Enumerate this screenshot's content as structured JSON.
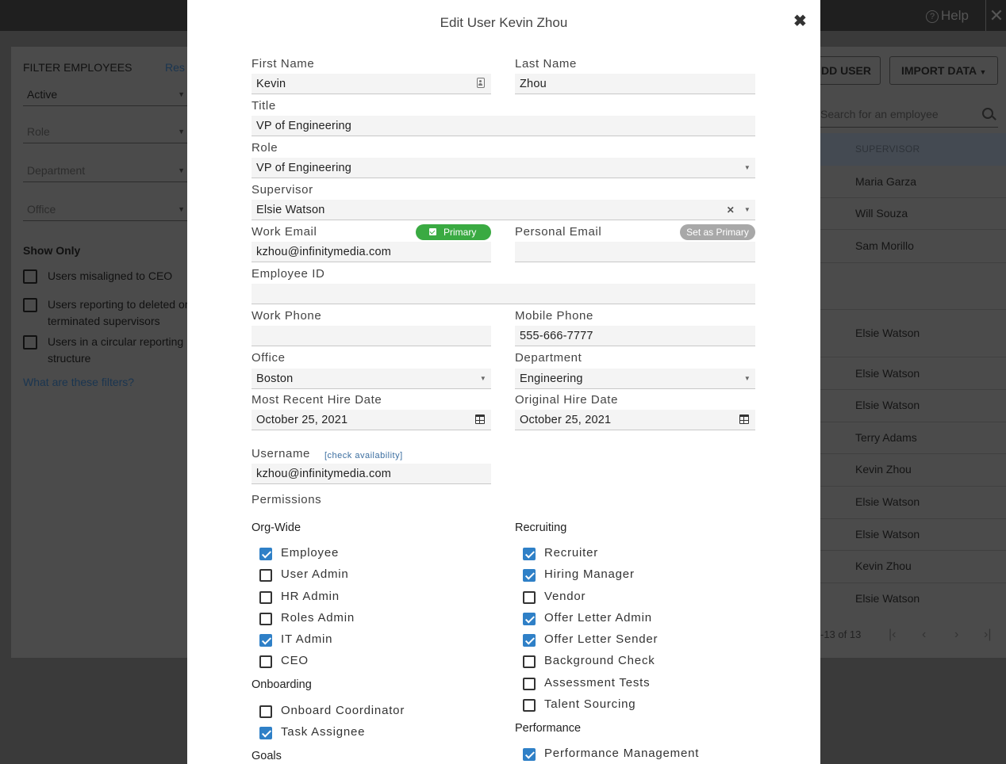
{
  "background": {
    "help_label": "Help",
    "filter": {
      "title": "FILTER EMPLOYEES",
      "reset_label": "Res",
      "status_value": "Active",
      "role_placeholder": "Role",
      "department_placeholder": "Department",
      "office_placeholder": "Office",
      "show_only_label": "Show Only",
      "checks": [
        "Users misaligned to CEO",
        "Users reporting to deleted or terminated supervisors",
        "Users in a circular reporting structure"
      ],
      "help_link": "What are these filters?"
    },
    "add_user_label": "DD USER",
    "import_data_label": "IMPORT DATA",
    "search_placeholder": "Search for an employee",
    "supervisor_header": "SUPERVISOR",
    "supervisors": [
      "Maria Garza",
      "Will Souza",
      "Sam Morillo",
      "",
      "Elsie Watson",
      "Elsie Watson",
      "Elsie Watson",
      "Terry Adams",
      "Kevin Zhou",
      "Elsie Watson",
      "Elsie Watson",
      "Kevin Zhou",
      "Elsie Watson"
    ],
    "pager_text": "-13 of 13"
  },
  "modal": {
    "title": "Edit User Kevin Zhou",
    "close_glyph": "✖",
    "fields": {
      "first_name": {
        "label": "First Name",
        "value": "Kevin"
      },
      "last_name": {
        "label": "Last Name",
        "value": "Zhou"
      },
      "title": {
        "label": "Title",
        "value": "VP of Engineering"
      },
      "role": {
        "label": "Role",
        "value": "VP of Engineering"
      },
      "supervisor": {
        "label": "Supervisor",
        "value": "Elsie Watson"
      },
      "work_email": {
        "label": "Work Email",
        "value": "kzhou@infinitymedia.com",
        "badge": "Primary"
      },
      "personal_email": {
        "label": "Personal Email",
        "value": "",
        "badge": "Set as Primary"
      },
      "employee_id": {
        "label": "Employee ID",
        "value": ""
      },
      "work_phone": {
        "label": "Work Phone",
        "value": ""
      },
      "mobile_phone": {
        "label": "Mobile Phone",
        "value": "555-666-7777"
      },
      "office": {
        "label": "Office",
        "value": "Boston"
      },
      "department": {
        "label": "Department",
        "value": "Engineering"
      },
      "recent_hire": {
        "label": "Most Recent Hire Date",
        "value": "October 25, 2021"
      },
      "original_hire": {
        "label": "Original Hire Date",
        "value": "October 25, 2021"
      },
      "username": {
        "label": "Username",
        "value": "kzhou@infinitymedia.com",
        "check_link": "[check availability]"
      }
    },
    "permissions_label": "Permissions",
    "org_wide": {
      "heading": "Org-Wide",
      "items": [
        {
          "label": "Employee",
          "checked": true
        },
        {
          "label": "User Admin",
          "checked": false
        },
        {
          "label": "HR Admin",
          "checked": false
        },
        {
          "label": "Roles Admin",
          "checked": false
        },
        {
          "label": "IT Admin",
          "checked": true
        },
        {
          "label": "CEO",
          "checked": false
        }
      ]
    },
    "onboarding": {
      "heading": "Onboarding",
      "items": [
        {
          "label": "Onboard Coordinator",
          "checked": false
        },
        {
          "label": "Task Assignee",
          "checked": true
        }
      ]
    },
    "goals": {
      "heading": "Goals"
    },
    "recruiting": {
      "heading": "Recruiting",
      "items": [
        {
          "label": "Recruiter",
          "checked": true
        },
        {
          "label": "Hiring Manager",
          "checked": true
        },
        {
          "label": "Vendor",
          "checked": false
        },
        {
          "label": "Offer Letter Admin",
          "checked": true
        },
        {
          "label": "Offer Letter Sender",
          "checked": true
        },
        {
          "label": "Background Check",
          "checked": false
        },
        {
          "label": "Assessment Tests",
          "checked": false
        },
        {
          "label": "Talent Sourcing",
          "checked": false
        }
      ]
    },
    "performance": {
      "heading": "Performance",
      "items": [
        {
          "label": "Performance Management",
          "checked": true
        }
      ]
    }
  }
}
